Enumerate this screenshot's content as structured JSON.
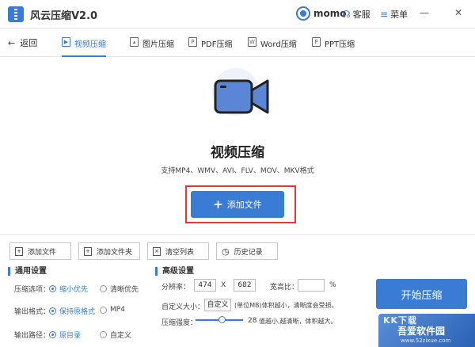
{
  "titlebar": {
    "title": "风云压缩V2.0",
    "user": "momo",
    "support": "客服",
    "menu": "菜单",
    "minimize": "—",
    "close": "✕"
  },
  "nav": {
    "back": "返回",
    "tabs": [
      {
        "label": "视频压缩",
        "icon": "video-icon",
        "active": true
      },
      {
        "label": "图片压缩",
        "icon": "image-icon"
      },
      {
        "label": "PDF压缩",
        "icon": "pdf-icon"
      },
      {
        "label": "Word压缩",
        "icon": "word-icon"
      },
      {
        "label": "PPT压缩",
        "icon": "ppt-icon"
      }
    ]
  },
  "hero": {
    "title": "视频压缩",
    "subtitle": "支持MP4、WMV、AVI、FLV、MOV、MKV格式",
    "add_button": "添加文件"
  },
  "toolbar": {
    "add_file": "添加文件",
    "add_folder": "添加文件夹",
    "clear_list": "清空列表",
    "history": "历史记录"
  },
  "general": {
    "title": "通用设置",
    "compress_label": "压缩选项：",
    "compress_opt1": "缩小优先",
    "compress_opt2": "清晰优先",
    "format_label": "输出格式：",
    "format_opt1": "保持原格式",
    "format_opt2": "MP4",
    "path_label": "输出路径：",
    "path_opt1": "原目录",
    "path_opt2": "自定义"
  },
  "advanced": {
    "title": "高级设置",
    "resolution_label": "分辨率：",
    "width": "474",
    "times": "X",
    "height": "682",
    "ratio_label": "宽高比：",
    "ratio_value": "",
    "percent": "%",
    "size_label": "自定义大小：",
    "size_button": "自定义",
    "size_hint": "(单位MB)体积越小，清晰度会受损。",
    "strength_label": "压缩强度：",
    "strength_value": 28,
    "strength_value_text": "28",
    "strength_hint": "值越小,越清晰，体积越大。"
  },
  "start_button": "开始压缩",
  "watermark": {
    "line1": "KK下载",
    "line2": "吾爱软件园",
    "line3": "www.52zixue.com"
  },
  "colors": {
    "accent": "#3a7bd5",
    "highlight": "#e03a3a"
  }
}
